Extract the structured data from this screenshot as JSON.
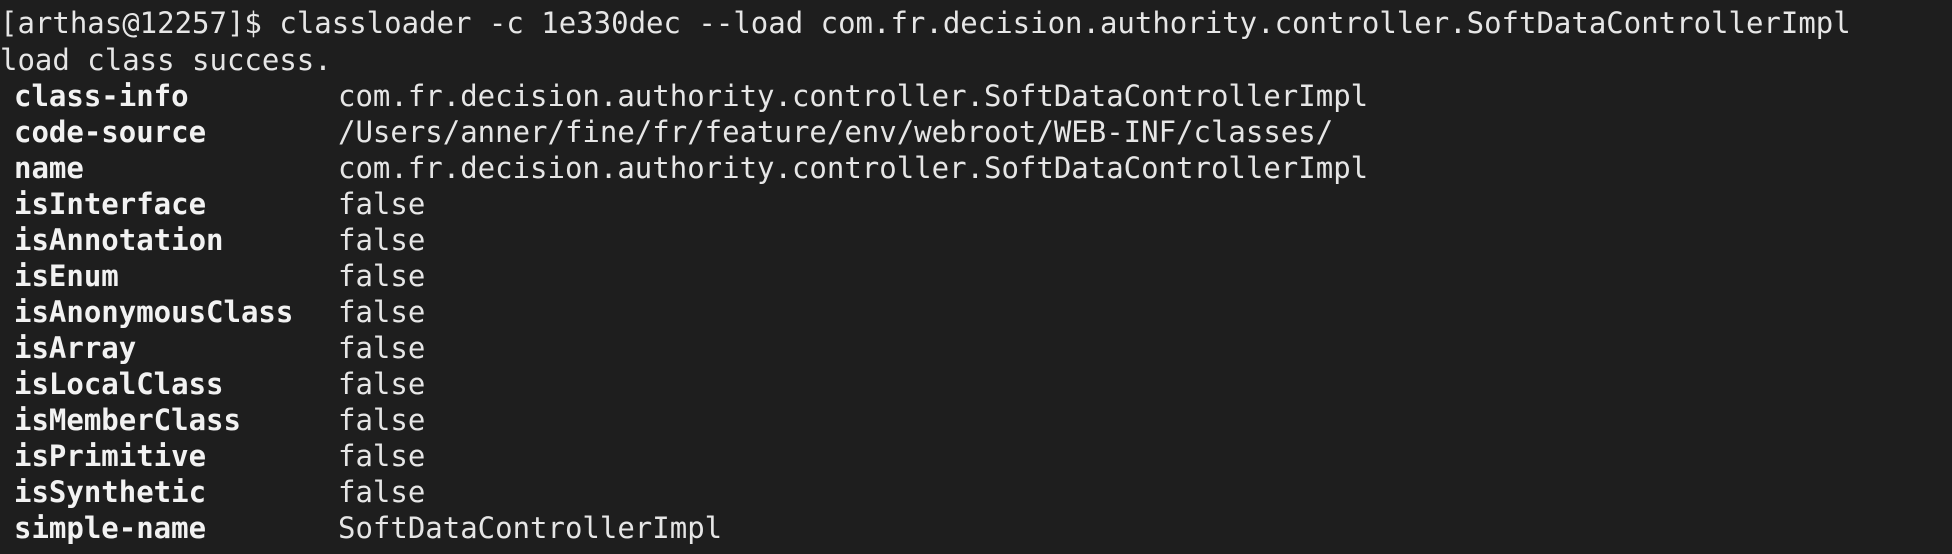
{
  "terminal": {
    "prompt": "[arthas@12257]$",
    "command": "classloader -c 1e330dec --load com.fr.decision.authority.controller.SoftDataControllerImpl",
    "status": "load class success.",
    "rows": [
      {
        "key": "class-info",
        "value": "com.fr.decision.authority.controller.SoftDataControllerImpl"
      },
      {
        "key": "code-source",
        "value": "/Users/anner/fine/fr/feature/env/webroot/WEB-INF/classes/"
      },
      {
        "key": "name",
        "value": "com.fr.decision.authority.controller.SoftDataControllerImpl"
      },
      {
        "key": "isInterface",
        "value": "false"
      },
      {
        "key": "isAnnotation",
        "value": "false"
      },
      {
        "key": "isEnum",
        "value": "false"
      },
      {
        "key": "isAnonymousClass",
        "value": "false"
      },
      {
        "key": "isArray",
        "value": "false"
      },
      {
        "key": "isLocalClass",
        "value": "false"
      },
      {
        "key": "isMemberClass",
        "value": "false"
      },
      {
        "key": "isPrimitive",
        "value": "false"
      },
      {
        "key": "isSynthetic",
        "value": "false"
      },
      {
        "key": "simple-name",
        "value": "SoftDataControllerImpl"
      }
    ]
  }
}
